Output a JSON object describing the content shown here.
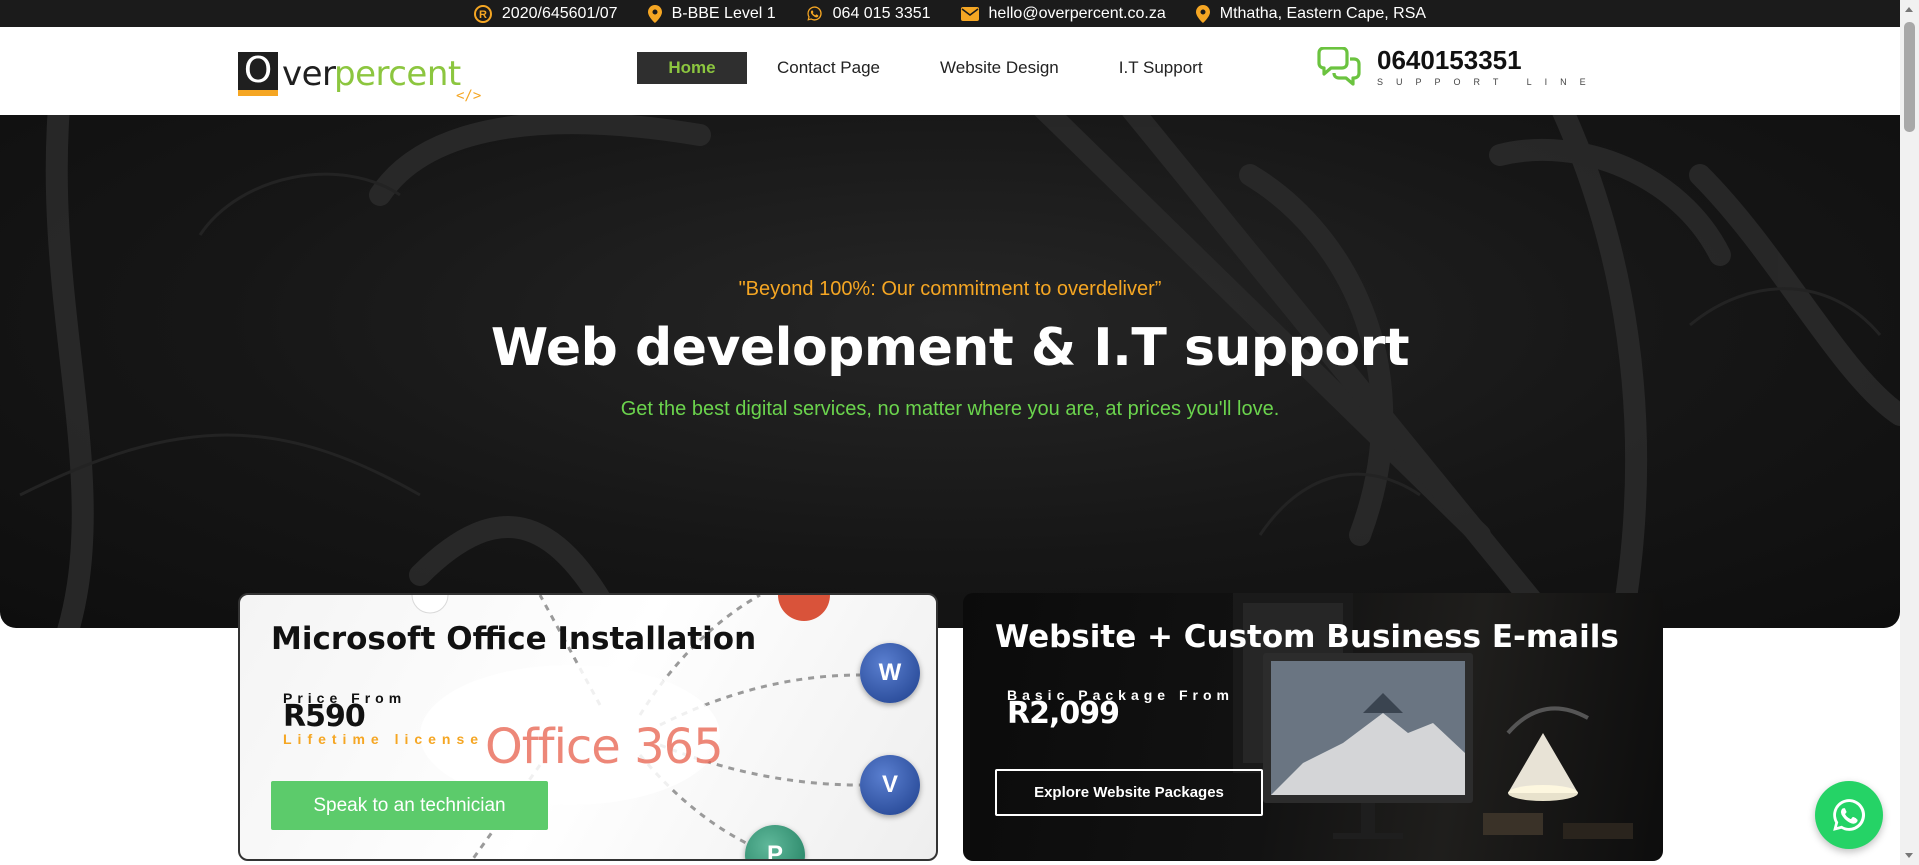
{
  "topbar": {
    "registration": "2020/645601/07",
    "bbbee": "B-BBE Level 1",
    "whatsapp": "064 015 3351",
    "email": "hello@overpercent.co.za",
    "location": "Mthatha, Eastern Cape, RSA",
    "icons": [
      "registered-icon",
      "location-pin-icon",
      "whatsapp-icon",
      "envelope-icon",
      "location-pin-icon"
    ],
    "icon_color": "#f5a623"
  },
  "header": {
    "logo": {
      "o": "O",
      "ver": "ver",
      "percent": "percent",
      "code": "</>"
    },
    "nav": [
      {
        "label": "Home",
        "active": true
      },
      {
        "label": "Contact Page",
        "active": false
      },
      {
        "label": "Website Design",
        "active": false
      },
      {
        "label": "I.T Support",
        "active": false
      }
    ],
    "support": {
      "number": "0640153351",
      "caption": "SUPPORT LINE",
      "icon": "chat-bubbles-icon"
    }
  },
  "hero": {
    "quote": "\"Beyond 100%: Our commitment to overdeliver”",
    "title": "Web development & I.T support",
    "subtitle": "Get the best digital services, no matter where you are, at prices you'll love."
  },
  "cards": {
    "office": {
      "title": "Microsoft Office Installation",
      "price_from": "Price From",
      "price": "R590",
      "note": "Lifetime license",
      "button": "Speak to an technician",
      "watermark": "Office 365"
    },
    "web": {
      "title": "Website + Custom Business E-mails",
      "price_from": "Basic Package From",
      "price": "R2,099",
      "button": "Explore Website Packages"
    }
  },
  "colors": {
    "accent_green": "#8cc63f",
    "accent_orange": "#f5a623",
    "button_green": "#5ccb6b",
    "whatsapp_green": "#25d366",
    "dark": "#1b1b1b"
  }
}
